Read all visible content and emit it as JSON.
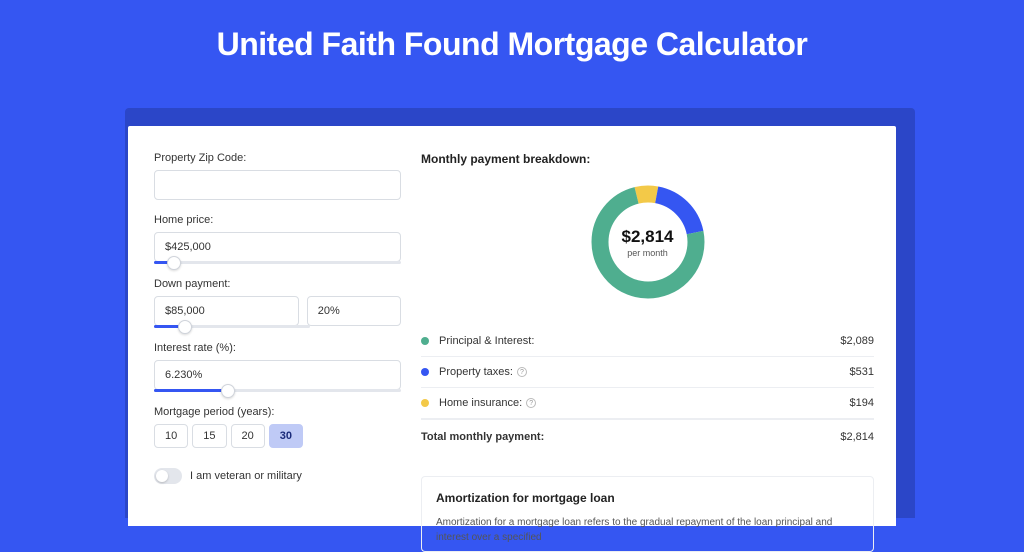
{
  "title": "United Faith Found Mortgage Calculator",
  "colors": {
    "green": "#4fae8f",
    "blue": "#3556f2",
    "yellow": "#f3c948"
  },
  "form": {
    "zip_label": "Property Zip Code:",
    "zip_value": "",
    "price_label": "Home price:",
    "price_value": "$425,000",
    "price_slider_pct": 8,
    "down_label": "Down payment:",
    "down_value": "$85,000",
    "down_pct_value": "20%",
    "down_slider_pct": 20,
    "rate_label": "Interest rate (%):",
    "rate_value": "6.230%",
    "rate_slider_pct": 30,
    "period_label": "Mortgage period (years):",
    "periods": [
      "10",
      "15",
      "20",
      "30"
    ],
    "period_active_idx": 3,
    "vet_label": "I am veteran or military"
  },
  "breakdown": {
    "heading": "Monthly payment breakdown:",
    "donut_value": "$2,814",
    "donut_sub": "per month",
    "items": [
      {
        "label": "Principal & Interest:",
        "value": "$2,089",
        "color": "green",
        "help": false,
        "pct": 74.2
      },
      {
        "label": "Property taxes:",
        "value": "$531",
        "color": "blue",
        "help": true,
        "pct": 18.9
      },
      {
        "label": "Home insurance:",
        "value": "$194",
        "color": "yellow",
        "help": true,
        "pct": 6.9
      }
    ],
    "total_label": "Total monthly payment:",
    "total_value": "$2,814"
  },
  "amort": {
    "heading": "Amortization for mortgage loan",
    "text": "Amortization for a mortgage loan refers to the gradual repayment of the loan principal and interest over a specified"
  },
  "chart_data": {
    "type": "pie",
    "title": "Monthly payment breakdown",
    "categories": [
      "Principal & Interest",
      "Property taxes",
      "Home insurance"
    ],
    "values": [
      2089,
      531,
      194
    ],
    "total": 2814,
    "unit": "USD per month"
  }
}
